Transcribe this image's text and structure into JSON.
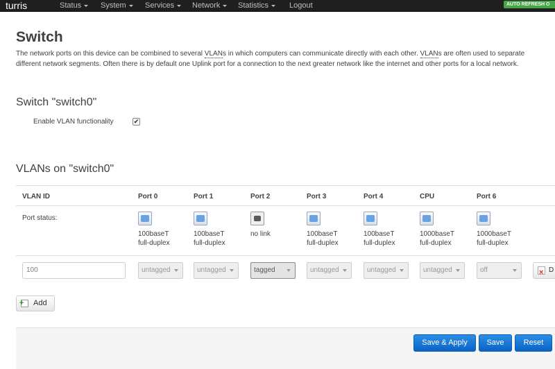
{
  "navbar": {
    "brand": "turris",
    "menus": [
      {
        "label": "Status"
      },
      {
        "label": "System"
      },
      {
        "label": "Services"
      },
      {
        "label": "Network"
      },
      {
        "label": "Statistics"
      }
    ],
    "logout": "Logout",
    "auto_refresh": "AUTO REFRESH O"
  },
  "page": {
    "title": "Switch",
    "desc_1": "The network ports on this device can be combined to several ",
    "desc_abbr1": "VLAN",
    "desc_2": "s in which computers can communicate directly with each other. ",
    "desc_abbr2": "VLAN",
    "desc_3": "s are often used to separate different network segments. Often there is by default one Uplink port for a connection to the next greater network like the internet and other ports for a local network."
  },
  "switch_section": {
    "title": "Switch \"switch0\"",
    "enable_vlan_label": "Enable VLAN functionality",
    "enable_vlan_checked": true,
    "check_glyph": "✔"
  },
  "vlans_section": {
    "title": "VLANs on \"switch0\"",
    "headers": [
      "VLAN ID",
      "Port 0",
      "Port 1",
      "Port 2",
      "Port 3",
      "Port 4",
      "CPU",
      "Port 6"
    ],
    "status_label": "Port status:",
    "port_status": [
      {
        "speed": "100baseT",
        "duplex": "full-duplex",
        "icon": "ethernet-link-icon"
      },
      {
        "speed": "100baseT",
        "duplex": "full-duplex",
        "icon": "ethernet-link-icon"
      },
      {
        "speed": "no link",
        "duplex": "",
        "icon": "ethernet-nolink-icon"
      },
      {
        "speed": "100baseT",
        "duplex": "full-duplex",
        "icon": "ethernet-link-icon"
      },
      {
        "speed": "100baseT",
        "duplex": "full-duplex",
        "icon": "ethernet-link-icon"
      },
      {
        "speed": "1000baseT",
        "duplex": "full-duplex",
        "icon": "ethernet-link-icon"
      },
      {
        "speed": "1000baseT",
        "duplex": "full-duplex",
        "icon": "ethernet-link-icon"
      }
    ],
    "row": {
      "vlan_id_placeholder": "100",
      "port_values": [
        "untagged",
        "untagged",
        "tagged",
        "untagged",
        "untagged",
        "untagged",
        "off"
      ],
      "delete_label": "D"
    },
    "add_label": "Add"
  },
  "footer": {
    "save_apply": "Save & Apply",
    "save": "Save",
    "reset": "Reset"
  },
  "colors": {
    "navbar_bg": "#1f1f1f",
    "auto_refresh_bg": "#46a546",
    "primary_button": "#0b63c6"
  }
}
